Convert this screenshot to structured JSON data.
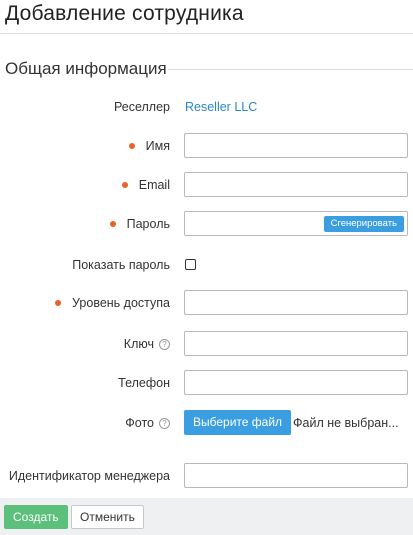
{
  "page": {
    "title": "Добавление сотрудника"
  },
  "section": {
    "title": "Общая информация"
  },
  "form": {
    "reseller": {
      "label": "Реселлер",
      "value": "Reseller LLC"
    },
    "name": {
      "label": "Имя",
      "value": "",
      "required": true
    },
    "email": {
      "label": "Email",
      "value": "",
      "required": true
    },
    "password": {
      "label": "Пароль",
      "value": "",
      "required": true,
      "generate_label": "Сгенерировать"
    },
    "show_password": {
      "label": "Показать пароль",
      "checked": false
    },
    "access_level": {
      "label": "Уровень доступа",
      "selected": "",
      "required": true
    },
    "key": {
      "label": "Ключ",
      "value": "",
      "help_icon": "question-circle-icon"
    },
    "phone": {
      "label": "Телефон",
      "value": ""
    },
    "photo": {
      "label": "Фото",
      "choose_label": "Выберите файл",
      "status": "Файл не выбран...",
      "help_icon": "question-circle-icon"
    },
    "manager_id": {
      "label": "Идентификатор менеджера",
      "value": ""
    }
  },
  "footer": {
    "create_label": "Создать",
    "cancel_label": "Отменить"
  },
  "colors": {
    "accent": "#3a9ee0",
    "required": "#e8622c",
    "create": "#5cbf7c",
    "link": "#2b87c6"
  }
}
